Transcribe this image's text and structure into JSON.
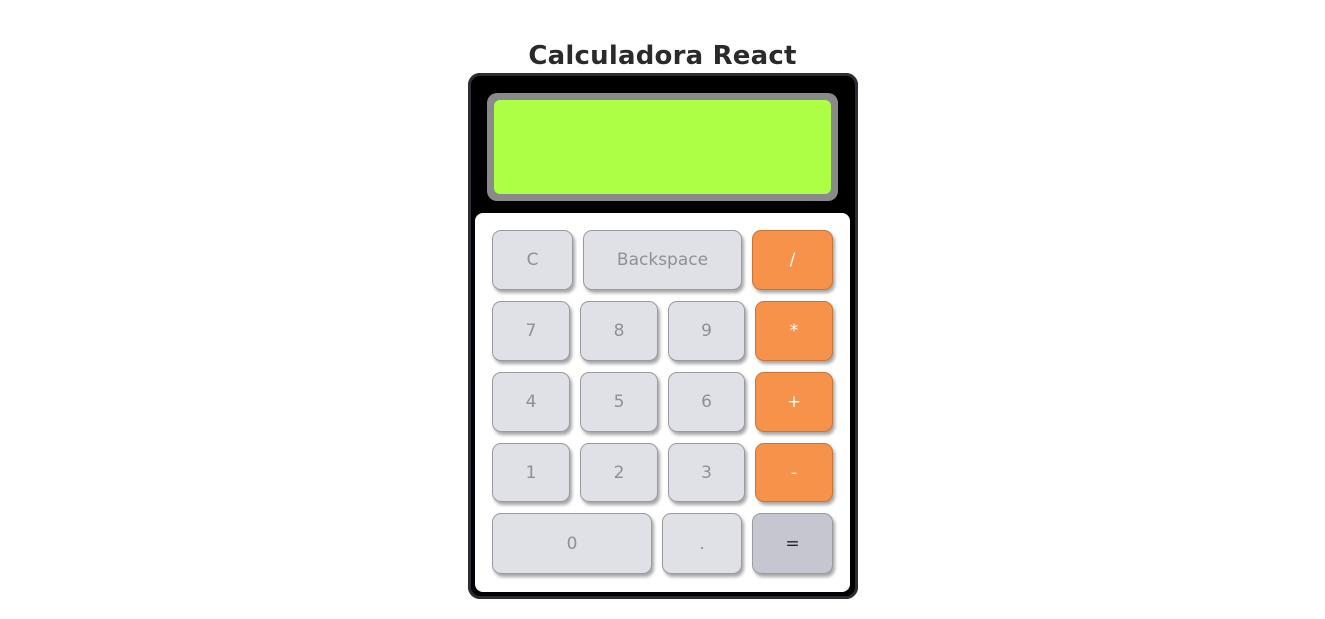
{
  "page": {
    "title": "Calculadora React"
  },
  "display": {
    "value": ""
  },
  "keys": {
    "clear": "C",
    "backspace": "Backspace",
    "divide": "/",
    "seven": "7",
    "eight": "8",
    "nine": "9",
    "multiply": "*",
    "four": "4",
    "five": "5",
    "six": "6",
    "add": "+",
    "one": "1",
    "two": "2",
    "three": "3",
    "subtract": "-",
    "zero": "0",
    "decimal": ".",
    "equals": "="
  },
  "colors": {
    "display_bg": "#adff45",
    "display_frame": "#8a8a8a",
    "body": "#000000",
    "key_default": "#e0e1e6",
    "key_operator": "#f7924b",
    "key_equals": "#c6c6d0"
  }
}
